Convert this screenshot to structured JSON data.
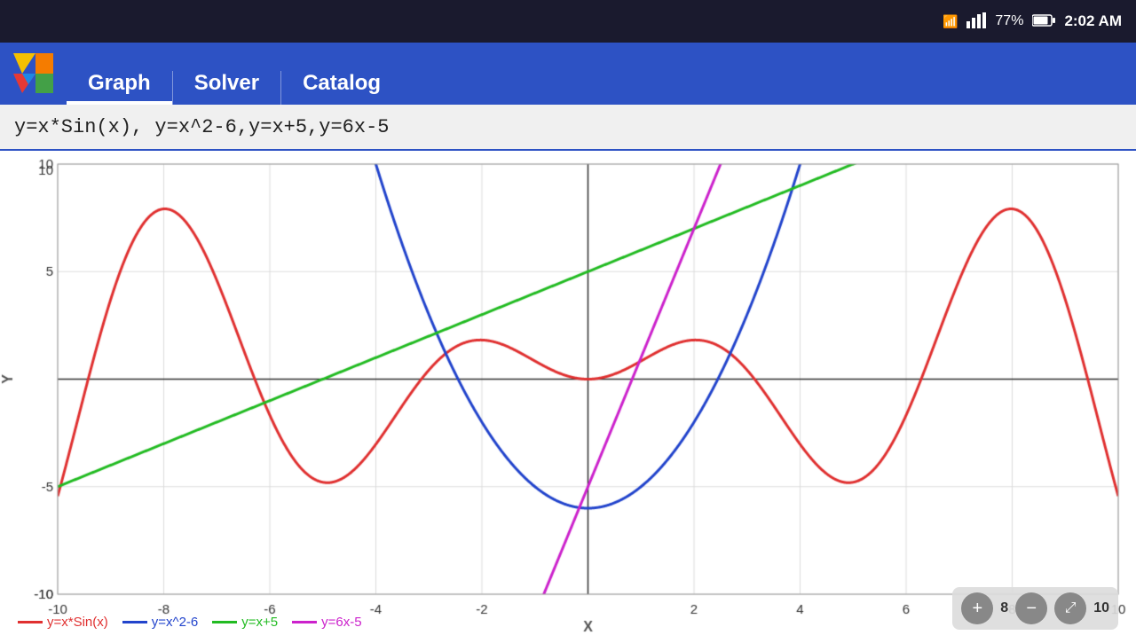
{
  "statusBar": {
    "wifi": "📶",
    "signal": "📶",
    "battery": "77%",
    "time": "2:02 AM"
  },
  "nav": {
    "tabs": [
      {
        "label": "Graph",
        "active": true
      },
      {
        "label": "Solver",
        "active": false
      },
      {
        "label": "Catalog",
        "active": false
      }
    ]
  },
  "formula": {
    "text": "y=x*Sin(x),  y=x^2-6,y=x+5,y=6x-5"
  },
  "legend": [
    {
      "label": "y=x*Sin(x)",
      "color": "#e03030"
    },
    {
      "label": "y=x^2-6",
      "color": "#2244cc"
    },
    {
      "label": "y=x+5",
      "color": "#22bb22"
    },
    {
      "label": "y=6x-5",
      "color": "#cc22cc"
    }
  ],
  "zoom": {
    "zoom_in": "+",
    "zoom_out": "−",
    "zoom_fit": "⤢",
    "range_label": "8",
    "range_label2": "10"
  },
  "graph": {
    "xMin": -10,
    "xMax": 10,
    "yMin": -10,
    "yMax": 10,
    "yLabel": "Y",
    "xLabel": "X"
  }
}
